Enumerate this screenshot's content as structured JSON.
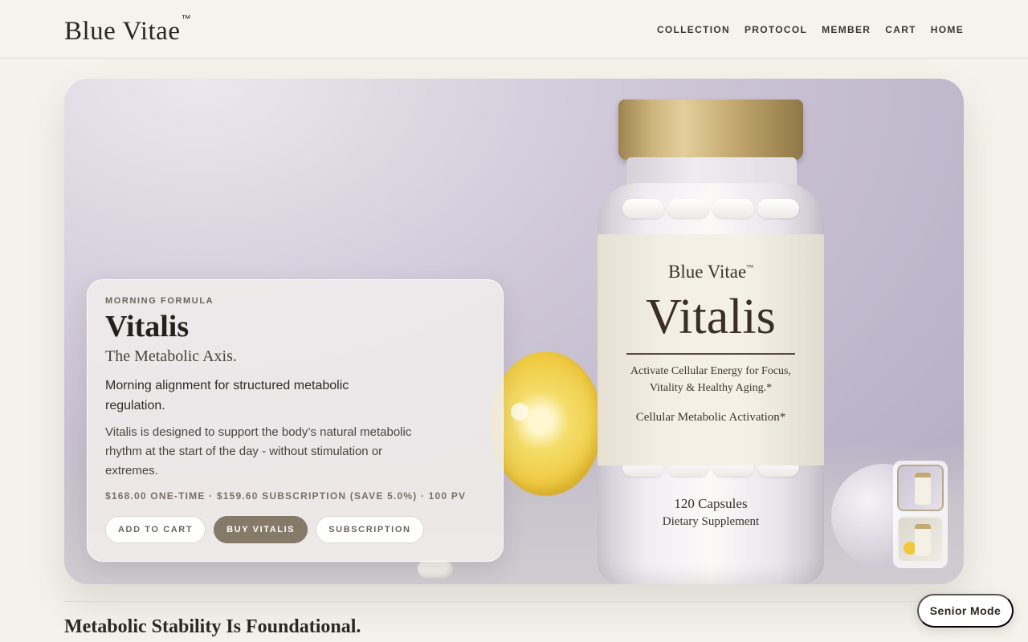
{
  "header": {
    "brand": "Blue Vitae",
    "brand_mark": "™",
    "nav": [
      "COLLECTION",
      "PROTOCOL",
      "MEMBER",
      "CART",
      "HOME"
    ]
  },
  "hero": {
    "eyebrow": "MORNING FORMULA",
    "title": "Vitalis",
    "subtitle": "The Metabolic Axis.",
    "lead": "Morning alignment for structured metabolic regulation.",
    "body": "Vitalis is designed to support the body’s natural metabolic rhythm at the start of the day - without stimulation or extremes.",
    "price_line": "$168.00 ONE-TIME · $159.60 SUBSCRIPTION (SAVE 5.0%) · 100 PV",
    "buttons": {
      "add_to_cart": "ADD TO CART",
      "buy": "BUY VITALIS",
      "subscription": "SUBSCRIPTION"
    },
    "bottle_label": {
      "brand": "Blue Vitae",
      "brand_mark": "™",
      "name": "Vitalis",
      "desc_line1": "Activate Cellular Energy for Focus,",
      "desc_line2": "Vitality & Healthy Aging.*",
      "activation": "Cellular Metabolic Activation*",
      "count": "120 Capsules",
      "type": "Dietary Supplement"
    },
    "thumbnails": [
      "thumbnail-1",
      "thumbnail-2"
    ]
  },
  "section": {
    "title": "Metabolic Stability Is Foundational."
  },
  "senior_mode": {
    "label": "Senior Mode"
  },
  "colors": {
    "background": "#f5f2ec",
    "accent": "#857968",
    "text": "#2c2a27"
  }
}
